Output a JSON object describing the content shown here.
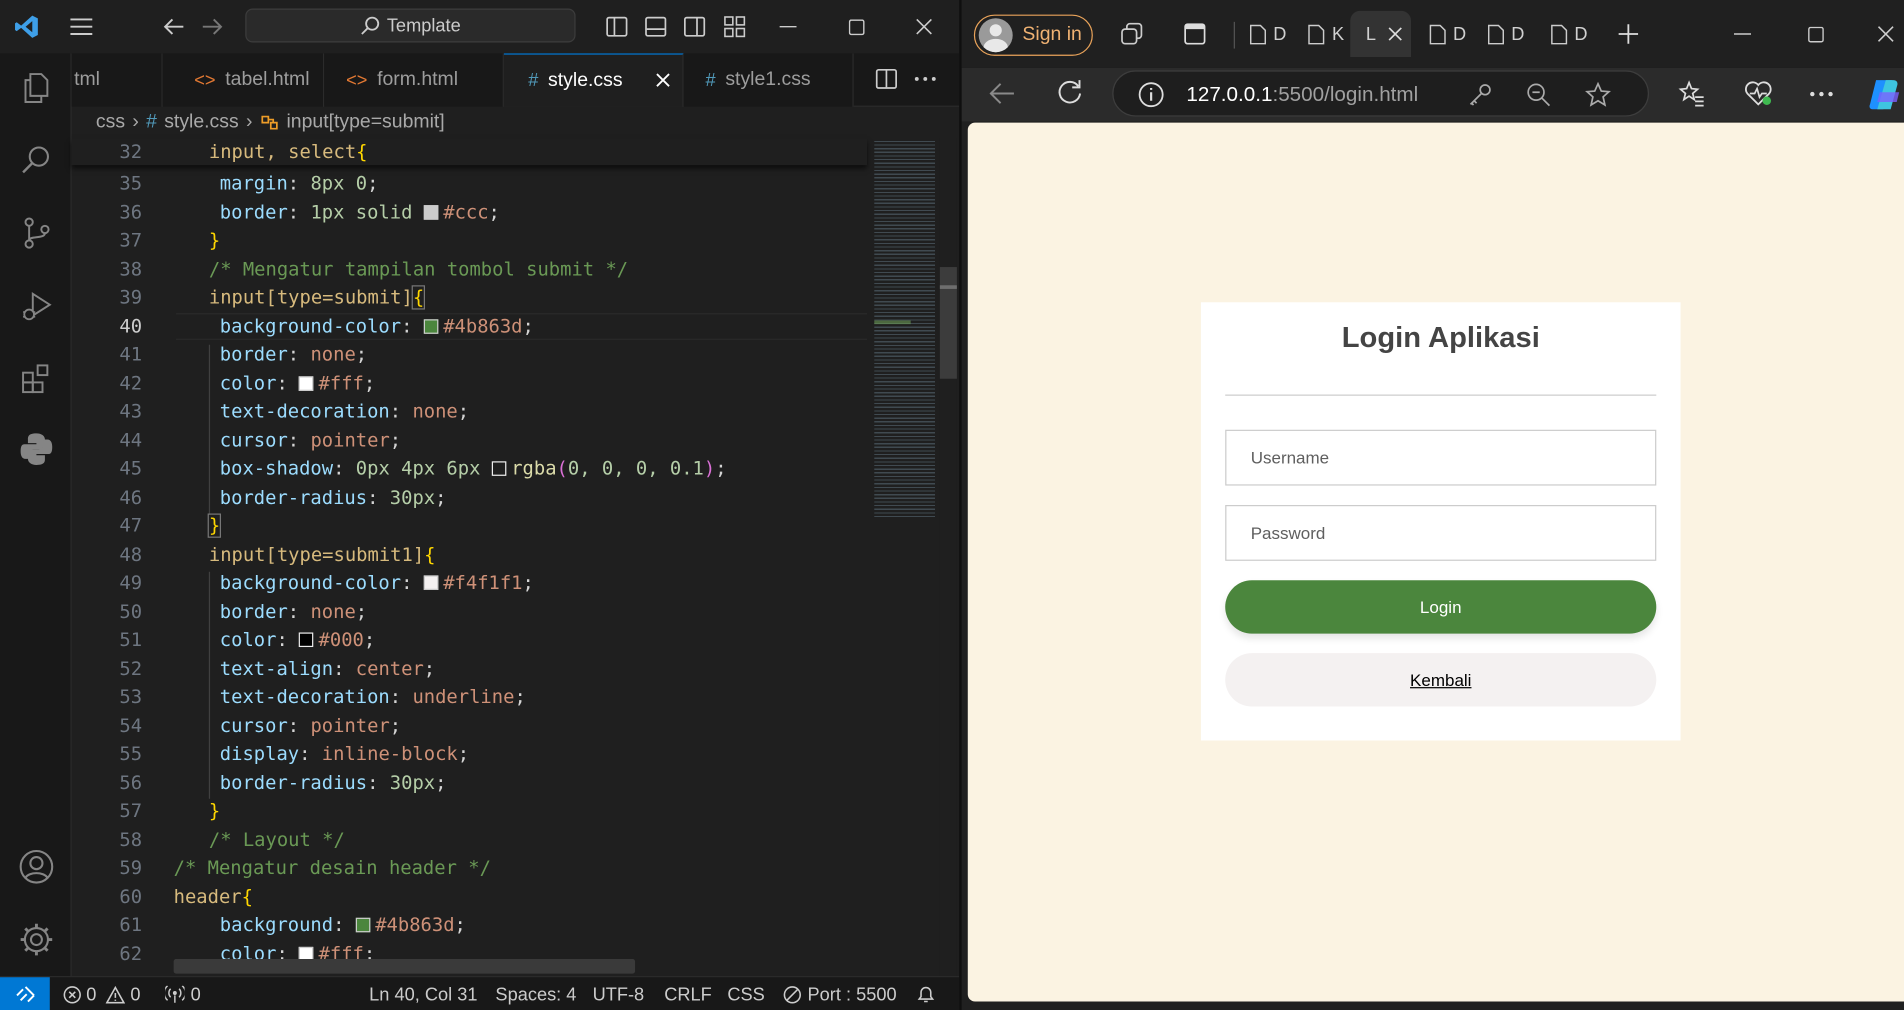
{
  "vscode": {
    "command_center": "Template",
    "tabs": [
      {
        "label": "tml",
        "icon": "html-icon"
      },
      {
        "label": "tabel.html",
        "icon": "html-icon"
      },
      {
        "label": "form.html",
        "icon": "html-icon"
      },
      {
        "label": "style.css",
        "icon": "css-icon",
        "active": true
      },
      {
        "label": "style1.css",
        "icon": "css-icon"
      }
    ],
    "breadcrumb": {
      "folder": "css",
      "file": "style.css",
      "symbol": "input[type=submit]"
    },
    "line_numbers": [
      "32",
      "35",
      "36",
      "37",
      "38",
      "39",
      "40",
      "41",
      "42",
      "43",
      "44",
      "45",
      "46",
      "47",
      "48",
      "49",
      "50",
      "51",
      "52",
      "53",
      "54",
      "55",
      "56",
      "57",
      "58",
      "59",
      "60",
      "61",
      "62"
    ],
    "code": {
      "l32_sel": "input, select",
      "l35_prop": "margin",
      "l35_val": "8px 0",
      "l36_prop": "border",
      "l36_val1": "1px solid",
      "l36_val2": "#ccc",
      "l38_comment": "/* Mengatur tampilan tombol submit */",
      "l39_sel": "input[type=submit]",
      "l40_prop": "background-color",
      "l40_val": "#4b863d",
      "l41_prop": "border",
      "l41_val": "none",
      "l42_prop": "color",
      "l42_val": "#fff",
      "l43_prop": "text-decoration",
      "l43_val": "none",
      "l44_prop": "cursor",
      "l44_val": "pointer",
      "l45_prop": "box-shadow",
      "l45_val": "0px 4px 6px",
      "l45_fn": "rgba",
      "l45_args": "0, 0, 0, 0.1",
      "l46_prop": "border-radius",
      "l46_val": "30px",
      "l48_sel": "input[type=submit1]",
      "l49_prop": "background-color",
      "l49_val": "#f4f1f1",
      "l50_prop": "border",
      "l50_val": "none",
      "l51_prop": "color",
      "l51_val": "#000",
      "l52_prop": "text-align",
      "l52_val": "center",
      "l53_prop": "text-decoration",
      "l53_val": "underline",
      "l54_prop": "cursor",
      "l54_val": "pointer",
      "l55_prop": "display",
      "l55_val": "inline-block",
      "l56_prop": "border-radius",
      "l56_val": "30px",
      "l58_comment": "/* Layout */",
      "l59_comment": "/* Mengatur desain header */",
      "l60_sel": "header",
      "l61_prop": "background",
      "l61_val": "#4b863d",
      "l62_prop": "color",
      "l62_val": "#fff"
    },
    "swatches": {
      "ccc": "#cccccc",
      "green": "#4b863d",
      "white": "#ffffff",
      "shadow": "#000000",
      "offwhite": "#f4f1f1",
      "black": "#000000"
    },
    "status": {
      "errors": "0",
      "warnings": "0",
      "ports": "0",
      "cursor": "Ln 40, Col 31",
      "spaces": "Spaces: 4",
      "encoding": "UTF-8",
      "eol": "CRLF",
      "language": "CSS",
      "port": "Port : 5500"
    }
  },
  "browser": {
    "sign_in": "Sign in",
    "tabs": [
      {
        "label": "D"
      },
      {
        "label": "K"
      },
      {
        "label": "L",
        "active": true
      },
      {
        "label": "D"
      },
      {
        "label": "D"
      },
      {
        "label": "D"
      }
    ],
    "url_host": "127.0.0.1",
    "url_path": ":5500/login.html"
  },
  "login": {
    "title": "Login Aplikasi",
    "username_placeholder": "Username",
    "password_placeholder": "Password",
    "login_button": "Login",
    "back_link": "Kembali"
  },
  "colors": {
    "accent": "#0078d4",
    "login_green": "#4b863d",
    "page_bg": "#fbf3e2",
    "signin_orange": "#f0b273"
  }
}
